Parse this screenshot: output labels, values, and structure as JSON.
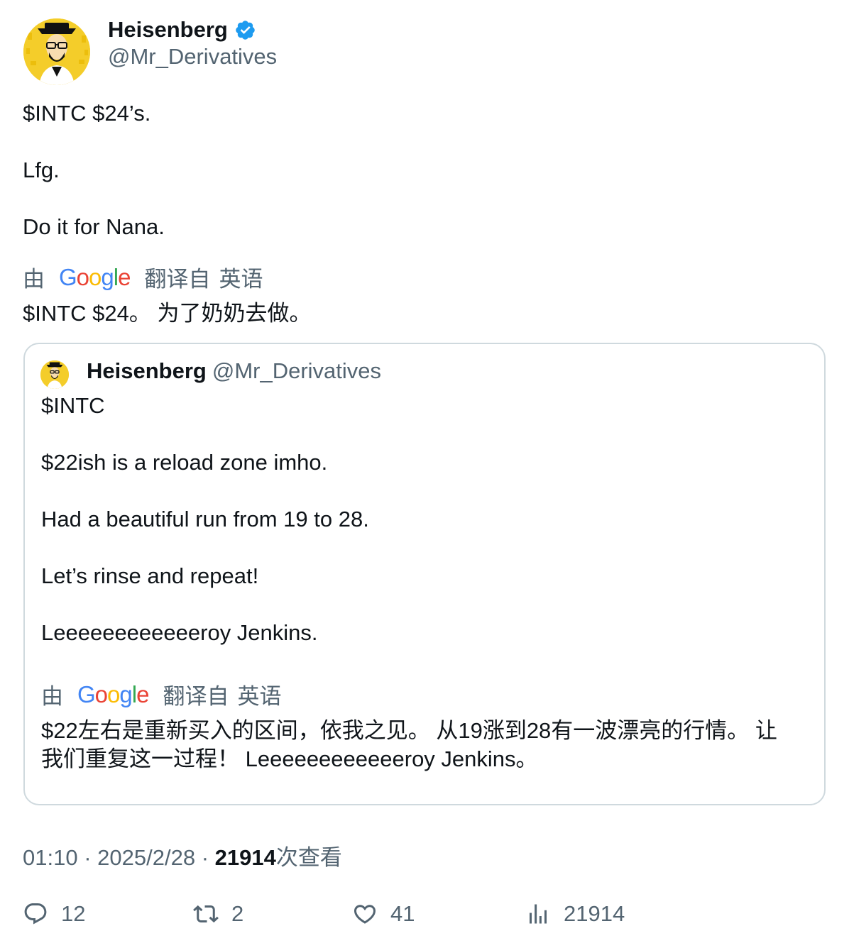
{
  "author": {
    "name": "Heisenberg",
    "handle": "@Mr_Derivatives"
  },
  "tweet": {
    "lines": [
      "$INTC $24’s.",
      "Lfg.",
      "Do it for Nana."
    ],
    "translation_prefix": "由",
    "translation_suffix": "翻译自",
    "translation_language": "英语",
    "translated_text": "$INTC $24。 为了奶奶去做。"
  },
  "google_logo": [
    "G",
    "o",
    "o",
    "g",
    "l",
    "e"
  ],
  "quoted_tweet": {
    "name": "Heisenberg",
    "handle": "@Mr_Derivatives",
    "lines": [
      "$INTC",
      "$22ish is a reload zone imho.",
      "Had a beautiful run from 19 to 28.",
      "Let’s rinse and repeat!",
      "Leeeeeeeeeeeeroy Jenkins."
    ],
    "translation_prefix": "由",
    "translation_suffix": "翻译自",
    "translation_language": "英语",
    "translated_line_1": "$22左右是重新买入的区间，依我之见。 从19涨到28有一波漂亮的行情。 让",
    "translated_line_2": "我们重复这一过程！ Leeeeeeeeeeeeroy Jenkins。"
  },
  "meta": {
    "time": "01:10",
    "separator": "·",
    "date": "2025/2/28",
    "views_count": "21914",
    "views_label": "次查看"
  },
  "actions": {
    "replies": "12",
    "retweets": "2",
    "likes": "41",
    "views": "21914"
  },
  "colors": {
    "verified": "#1d9bf0",
    "secondary_text": "#536471",
    "border": "#cfd9de",
    "avatar_bg": "#f4cd2a"
  }
}
